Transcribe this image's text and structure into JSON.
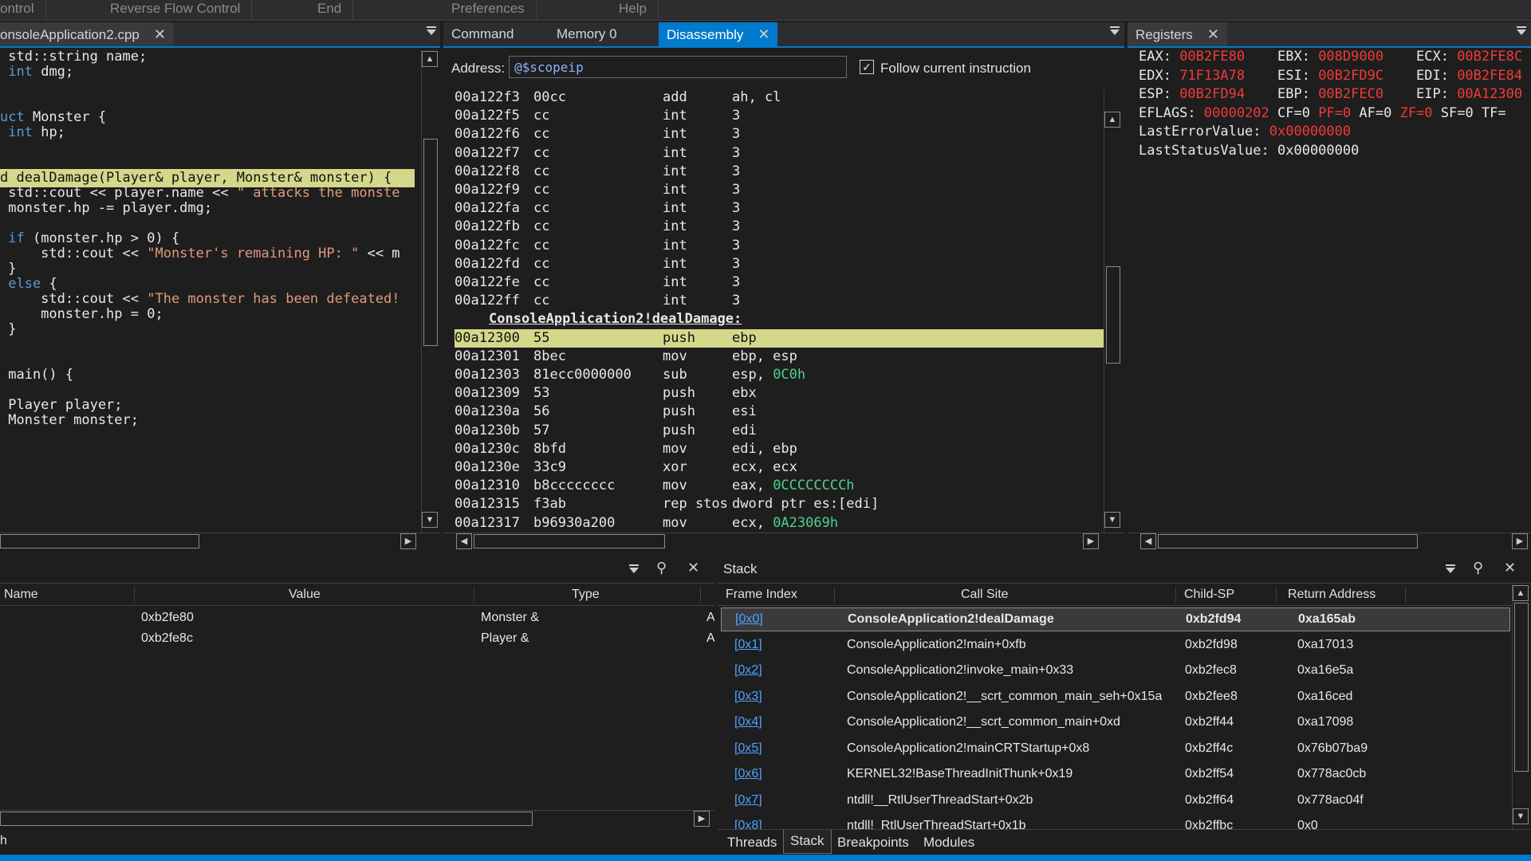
{
  "menu": {
    "items": [
      "ontrol",
      "Reverse Flow Control",
      "End",
      "Preferences",
      "Help"
    ]
  },
  "source_panel": {
    "tab_label": "onsoleApplication2.cpp",
    "lines": [
      {
        "parts": [
          {
            "t": " std::string name;",
            "c": ""
          }
        ]
      },
      {
        "parts": [
          {
            "t": " ",
            "c": ""
          },
          {
            "t": "int",
            "c": "kw"
          },
          {
            "t": " dmg;",
            "c": ""
          }
        ]
      },
      {
        "parts": [
          {
            "t": "",
            "c": ""
          }
        ]
      },
      {
        "parts": [
          {
            "t": "",
            "c": ""
          }
        ]
      },
      {
        "parts": [
          {
            "t": "uct",
            "c": "kw"
          },
          {
            "t": " Monster {",
            "c": ""
          }
        ]
      },
      {
        "parts": [
          {
            "t": " ",
            "c": ""
          },
          {
            "t": "int",
            "c": "kw"
          },
          {
            "t": " hp;",
            "c": ""
          }
        ]
      },
      {
        "parts": [
          {
            "t": "",
            "c": ""
          }
        ]
      },
      {
        "parts": [
          {
            "t": "",
            "c": ""
          }
        ]
      },
      {
        "parts": [
          {
            "t": "d dealDamage(Player& player, Monster& monster) {",
            "c": ""
          }
        ],
        "highlight": true
      },
      {
        "parts": [
          {
            "t": " std::cout << player.name << ",
            "c": ""
          },
          {
            "t": "\" attacks the monste",
            "c": "str"
          }
        ]
      },
      {
        "parts": [
          {
            "t": " monster.hp -= player.dmg;",
            "c": ""
          }
        ]
      },
      {
        "parts": [
          {
            "t": "",
            "c": ""
          }
        ]
      },
      {
        "parts": [
          {
            "t": " ",
            "c": ""
          },
          {
            "t": "if",
            "c": "kw"
          },
          {
            "t": " (monster.hp > 0) {",
            "c": ""
          }
        ]
      },
      {
        "parts": [
          {
            "t": "     std::cout << ",
            "c": ""
          },
          {
            "t": "\"Monster's remaining HP: \"",
            "c": "str"
          },
          {
            "t": " << m",
            "c": ""
          }
        ]
      },
      {
        "parts": [
          {
            "t": " }",
            "c": ""
          }
        ]
      },
      {
        "parts": [
          {
            "t": " ",
            "c": ""
          },
          {
            "t": "else",
            "c": "kw"
          },
          {
            "t": " {",
            "c": ""
          }
        ]
      },
      {
        "parts": [
          {
            "t": "     std::cout << ",
            "c": ""
          },
          {
            "t": "\"The monster has been defeated!",
            "c": "str"
          }
        ]
      },
      {
        "parts": [
          {
            "t": "     monster.hp = 0;",
            "c": ""
          }
        ]
      },
      {
        "parts": [
          {
            "t": " }",
            "c": ""
          }
        ]
      },
      {
        "parts": [
          {
            "t": "",
            "c": ""
          }
        ]
      },
      {
        "parts": [
          {
            "t": "",
            "c": ""
          }
        ]
      },
      {
        "parts": [
          {
            "t": " main() {",
            "c": ""
          }
        ]
      },
      {
        "parts": [
          {
            "t": "",
            "c": ""
          }
        ]
      },
      {
        "parts": [
          {
            "t": " Player player;",
            "c": ""
          }
        ]
      },
      {
        "parts": [
          {
            "t": " Monster monster;",
            "c": ""
          }
        ]
      }
    ]
  },
  "center_panel": {
    "tabs": [
      "Command",
      "Memory 0",
      "Disassembly"
    ],
    "active_tab": "Disassembly",
    "address_label": "Address:",
    "address_value": "@$scopeip",
    "follow_label": "Follow current instruction",
    "follow_checked": true,
    "label_line": "ConsoleApplication2!dealDamage:",
    "rows_before": [
      {
        "addr": "00a122f3",
        "bytes": "00cc",
        "mn": "add",
        "ops": [
          {
            "t": "ah, cl",
            "c": ""
          }
        ]
      },
      {
        "addr": "00a122f5",
        "bytes": "cc",
        "mn": "int",
        "ops": [
          {
            "t": "3",
            "c": ""
          }
        ]
      },
      {
        "addr": "00a122f6",
        "bytes": "cc",
        "mn": "int",
        "ops": [
          {
            "t": "3",
            "c": ""
          }
        ]
      },
      {
        "addr": "00a122f7",
        "bytes": "cc",
        "mn": "int",
        "ops": [
          {
            "t": "3",
            "c": ""
          }
        ]
      },
      {
        "addr": "00a122f8",
        "bytes": "cc",
        "mn": "int",
        "ops": [
          {
            "t": "3",
            "c": ""
          }
        ]
      },
      {
        "addr": "00a122f9",
        "bytes": "cc",
        "mn": "int",
        "ops": [
          {
            "t": "3",
            "c": ""
          }
        ]
      },
      {
        "addr": "00a122fa",
        "bytes": "cc",
        "mn": "int",
        "ops": [
          {
            "t": "3",
            "c": ""
          }
        ]
      },
      {
        "addr": "00a122fb",
        "bytes": "cc",
        "mn": "int",
        "ops": [
          {
            "t": "3",
            "c": ""
          }
        ]
      },
      {
        "addr": "00a122fc",
        "bytes": "cc",
        "mn": "int",
        "ops": [
          {
            "t": "3",
            "c": ""
          }
        ]
      },
      {
        "addr": "00a122fd",
        "bytes": "cc",
        "mn": "int",
        "ops": [
          {
            "t": "3",
            "c": ""
          }
        ]
      },
      {
        "addr": "00a122fe",
        "bytes": "cc",
        "mn": "int",
        "ops": [
          {
            "t": "3",
            "c": ""
          }
        ]
      },
      {
        "addr": "00a122ff",
        "bytes": "cc",
        "mn": "int",
        "ops": [
          {
            "t": "3",
            "c": ""
          }
        ]
      }
    ],
    "rows_after": [
      {
        "addr": "00a12300",
        "bytes": "55",
        "mn": "push",
        "ops": [
          {
            "t": "ebp",
            "c": ""
          }
        ],
        "current": true
      },
      {
        "addr": "00a12301",
        "bytes": "8bec",
        "mn": "mov",
        "ops": [
          {
            "t": "ebp, esp",
            "c": ""
          }
        ]
      },
      {
        "addr": "00a12303",
        "bytes": "81ecc0000000",
        "mn": "sub",
        "ops": [
          {
            "t": "esp, ",
            "c": ""
          },
          {
            "t": "0C0h",
            "c": "imm"
          }
        ]
      },
      {
        "addr": "00a12309",
        "bytes": "53",
        "mn": "push",
        "ops": [
          {
            "t": "ebx",
            "c": ""
          }
        ]
      },
      {
        "addr": "00a1230a",
        "bytes": "56",
        "mn": "push",
        "ops": [
          {
            "t": "esi",
            "c": ""
          }
        ]
      },
      {
        "addr": "00a1230b",
        "bytes": "57",
        "mn": "push",
        "ops": [
          {
            "t": "edi",
            "c": ""
          }
        ]
      },
      {
        "addr": "00a1230c",
        "bytes": "8bfd",
        "mn": "mov",
        "ops": [
          {
            "t": "edi, ebp",
            "c": ""
          }
        ]
      },
      {
        "addr": "00a1230e",
        "bytes": "33c9",
        "mn": "xor",
        "ops": [
          {
            "t": "ecx, ecx",
            "c": ""
          }
        ]
      },
      {
        "addr": "00a12310",
        "bytes": "b8cccccccc",
        "mn": "mov",
        "ops": [
          {
            "t": "eax, ",
            "c": ""
          },
          {
            "t": "0CCCCCCCCh",
            "c": "imm"
          }
        ]
      },
      {
        "addr": "00a12315",
        "bytes": "f3ab",
        "mn": "rep stos",
        "ops": [
          {
            "t": "dword ptr es:[edi]",
            "c": ""
          }
        ]
      },
      {
        "addr": "00a12317",
        "bytes": "b96930a200",
        "mn": "mov",
        "ops": [
          {
            "t": "ecx, ",
            "c": ""
          },
          {
            "t": "0A23069h",
            "c": "imm"
          }
        ]
      }
    ]
  },
  "registers_panel": {
    "tab_label": "Registers",
    "rows": [
      [
        {
          "name": "EAX:",
          "value": "00B2FE80",
          "changed": true
        },
        {
          "name": "EBX:",
          "value": "008D9000",
          "changed": true
        },
        {
          "name": "ECX:",
          "value": "00B2FE8C",
          "changed": true
        }
      ],
      [
        {
          "name": "EDX:",
          "value": "71F13A78",
          "changed": true
        },
        {
          "name": "ESI:",
          "value": "00B2FD9C",
          "changed": true
        },
        {
          "name": "EDI:",
          "value": "00B2FE84",
          "changed": true
        }
      ],
      [
        {
          "name": "ESP:",
          "value": "00B2FD94",
          "changed": true
        },
        {
          "name": "EBP:",
          "value": "00B2FEC0",
          "changed": true
        },
        {
          "name": "EIP:",
          "value": "00A12300",
          "changed": true
        }
      ]
    ],
    "eflags": [
      {
        "t": "EFLAGS: ",
        "c": ""
      },
      {
        "t": "00000202",
        "c": "red"
      },
      {
        "t": " CF=0 ",
        "c": ""
      },
      {
        "t": "PF=0",
        "c": "red"
      },
      {
        "t": " AF=0 ",
        "c": ""
      },
      {
        "t": "ZF=0",
        "c": "red"
      },
      {
        "t": " SF=0 TF=",
        "c": ""
      }
    ],
    "last_error_label": "LastErrorValue: ",
    "last_error_value": "0x00000000",
    "last_status_label": "LastStatusValue: ",
    "last_status_value": "0x00000000"
  },
  "locals_panel": {
    "columns": [
      "Name",
      "Value",
      "Type"
    ],
    "rows": [
      {
        "value": "0xb2fe80",
        "type": "Monster &",
        "extra": "A"
      },
      {
        "value": "0xb2fe8c",
        "type": "Player &",
        "extra": "A"
      }
    ],
    "bottom_fragment": "h"
  },
  "stack_panel": {
    "title": "Stack",
    "columns": [
      "Frame Index",
      "Call Site",
      "Child-SP",
      "Return Address"
    ],
    "rows": [
      {
        "frame": "[0x0]",
        "site": "ConsoleApplication2!dealDamage",
        "sp": "0xb2fd94",
        "ret": "0xa165ab",
        "selected": true
      },
      {
        "frame": "[0x1]",
        "site": "ConsoleApplication2!main+0xfb",
        "sp": "0xb2fd98",
        "ret": "0xa17013"
      },
      {
        "frame": "[0x2]",
        "site": "ConsoleApplication2!invoke_main+0x33",
        "sp": "0xb2fec8",
        "ret": "0xa16e5a"
      },
      {
        "frame": "[0x3]",
        "site": "ConsoleApplication2!__scrt_common_main_seh+0x15a",
        "sp": "0xb2fee8",
        "ret": "0xa16ced"
      },
      {
        "frame": "[0x4]",
        "site": "ConsoleApplication2!__scrt_common_main+0xd",
        "sp": "0xb2ff44",
        "ret": "0xa17098"
      },
      {
        "frame": "[0x5]",
        "site": "ConsoleApplication2!mainCRTStartup+0x8",
        "sp": "0xb2ff4c",
        "ret": "0x76b07ba9"
      },
      {
        "frame": "[0x6]",
        "site": "KERNEL32!BaseThreadInitThunk+0x19",
        "sp": "0xb2ff54",
        "ret": "0x778ac0cb"
      },
      {
        "frame": "[0x7]",
        "site": "ntdll!__RtlUserThreadStart+0x2b",
        "sp": "0xb2ff64",
        "ret": "0x778ac04f"
      },
      {
        "frame": "[0x8]",
        "site": "ntdll!_RtlUserThreadStart+0x1b",
        "sp": "0xb2ffbc",
        "ret": "0x0"
      }
    ],
    "bottom_tabs": [
      "Threads",
      "Stack",
      "Breakpoints",
      "Modules"
    ],
    "active_bottom_tab": "Stack"
  },
  "colors": {
    "accent": "#007acc",
    "current_line_highlight": "#d3d88a",
    "changed_register": "#f03a3a",
    "immediate": "#4ed18b",
    "keyword": "#569cd6",
    "string": "#e09a7a",
    "link": "#4da3ff"
  }
}
